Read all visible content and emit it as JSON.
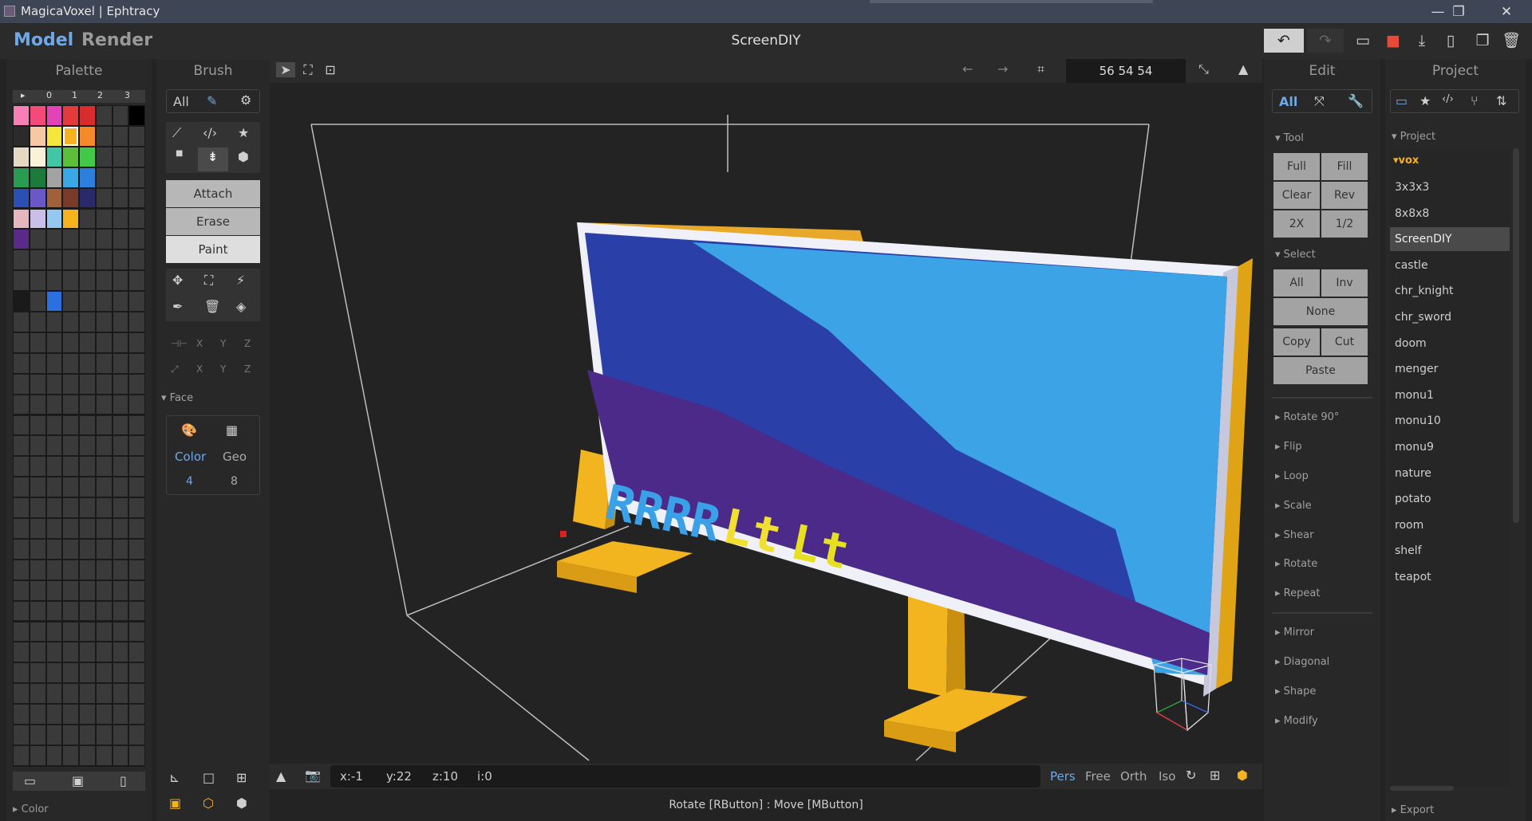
{
  "window": {
    "title": "MagicaVoxel | Ephtracy",
    "minimize": "—",
    "restore": "❐",
    "close": "✕"
  },
  "menu": {
    "model": "Model",
    "render": "Render",
    "project_name": "ScreenDIY"
  },
  "palette": {
    "header": "Palette",
    "page_tabs": [
      "▸",
      "0",
      "1",
      "2",
      "3"
    ],
    "footer_label": "Color",
    "colors": [
      "#f77fb6",
      "#f34a7a",
      "#e343b6",
      "#e33b3b",
      "#d92c2c",
      "#3a3a3a",
      "#3a3a3a",
      "#000000",
      "#2b2b2b",
      "#f5c9a6",
      "#f5e63c",
      "#f6b21f",
      "#f58a2a",
      "#3a3a3a",
      "#3a3a3a",
      "#3a3a3a",
      "#e6d9c3",
      "#f7f2d8",
      "#42c7a6",
      "#5cbf3a",
      "#43c94a",
      "#3a3a3a",
      "#3a3a3a",
      "#3a3a3a",
      "#2a9c52",
      "#1d7a3d",
      "#a3a3a3",
      "#3aa7e6",
      "#2c7fdc",
      "#3a3a3a",
      "#3a3a3a",
      "#3a3a3a",
      "#2c4fb6",
      "#6a58c9",
      "#a0603a",
      "#7a3a2a",
      "#2a2a6a",
      "#3a3a3a",
      "#3a3a3a",
      "#3a3a3a",
      "#e6b6c0",
      "#c9bfe9",
      "#93c9f0",
      "#f6b21f",
      "#3a3a3a",
      "#3a3a3a",
      "#3a3a3a",
      "#3a3a3a",
      "#5a2a8a"
    ]
  },
  "brush": {
    "header": "Brush",
    "all": "All",
    "modes": [
      "Attach",
      "Erase",
      "Paint"
    ],
    "axis": [
      "X",
      "Y",
      "Z"
    ],
    "face_section": "Face",
    "face_color": "Color",
    "face_geo": "Geo",
    "face_color_val": "4",
    "face_geo_val": "8"
  },
  "viewport": {
    "dims": "56  54  54",
    "coords": {
      "x": "x:-1",
      "y": "y:22",
      "z": "z:10",
      "i": "i:0"
    },
    "views": [
      "Pers",
      "Free",
      "Orth",
      "Iso"
    ],
    "sign_text": "RRRRLtLt",
    "status": "Rotate [RButton] : Move [MButton]"
  },
  "edit": {
    "header": "Edit",
    "all": "All",
    "tool_section": "Tool",
    "tool_buttons": [
      "Full",
      "Fill",
      "Clear",
      "Rev",
      "2X",
      "1/2"
    ],
    "select_section": "Select",
    "select_buttons": [
      "All",
      "Inv",
      "None",
      "Copy",
      "Cut",
      "Paste"
    ],
    "sections": [
      "Rotate 90°",
      "Flip",
      "Loop",
      "Scale",
      "Shear",
      "Rotate",
      "Repeat",
      "Mirror",
      "Diagonal",
      "Shape",
      "Modify"
    ]
  },
  "project": {
    "header": "Project",
    "section": "Project",
    "folder": "vox",
    "items": [
      "3x3x3",
      "8x8x8",
      "ScreenDIY",
      "castle",
      "chr_knight",
      "chr_sword",
      "doom",
      "menger",
      "monu1",
      "monu10",
      "monu9",
      "nature",
      "potato",
      "room",
      "shelf",
      "teapot"
    ],
    "selected": "ScreenDIY",
    "export": "Export"
  },
  "colors": {
    "accent": "#6fa8e8",
    "selected_palette": "#f6b21f",
    "record": "#e84a3a"
  }
}
